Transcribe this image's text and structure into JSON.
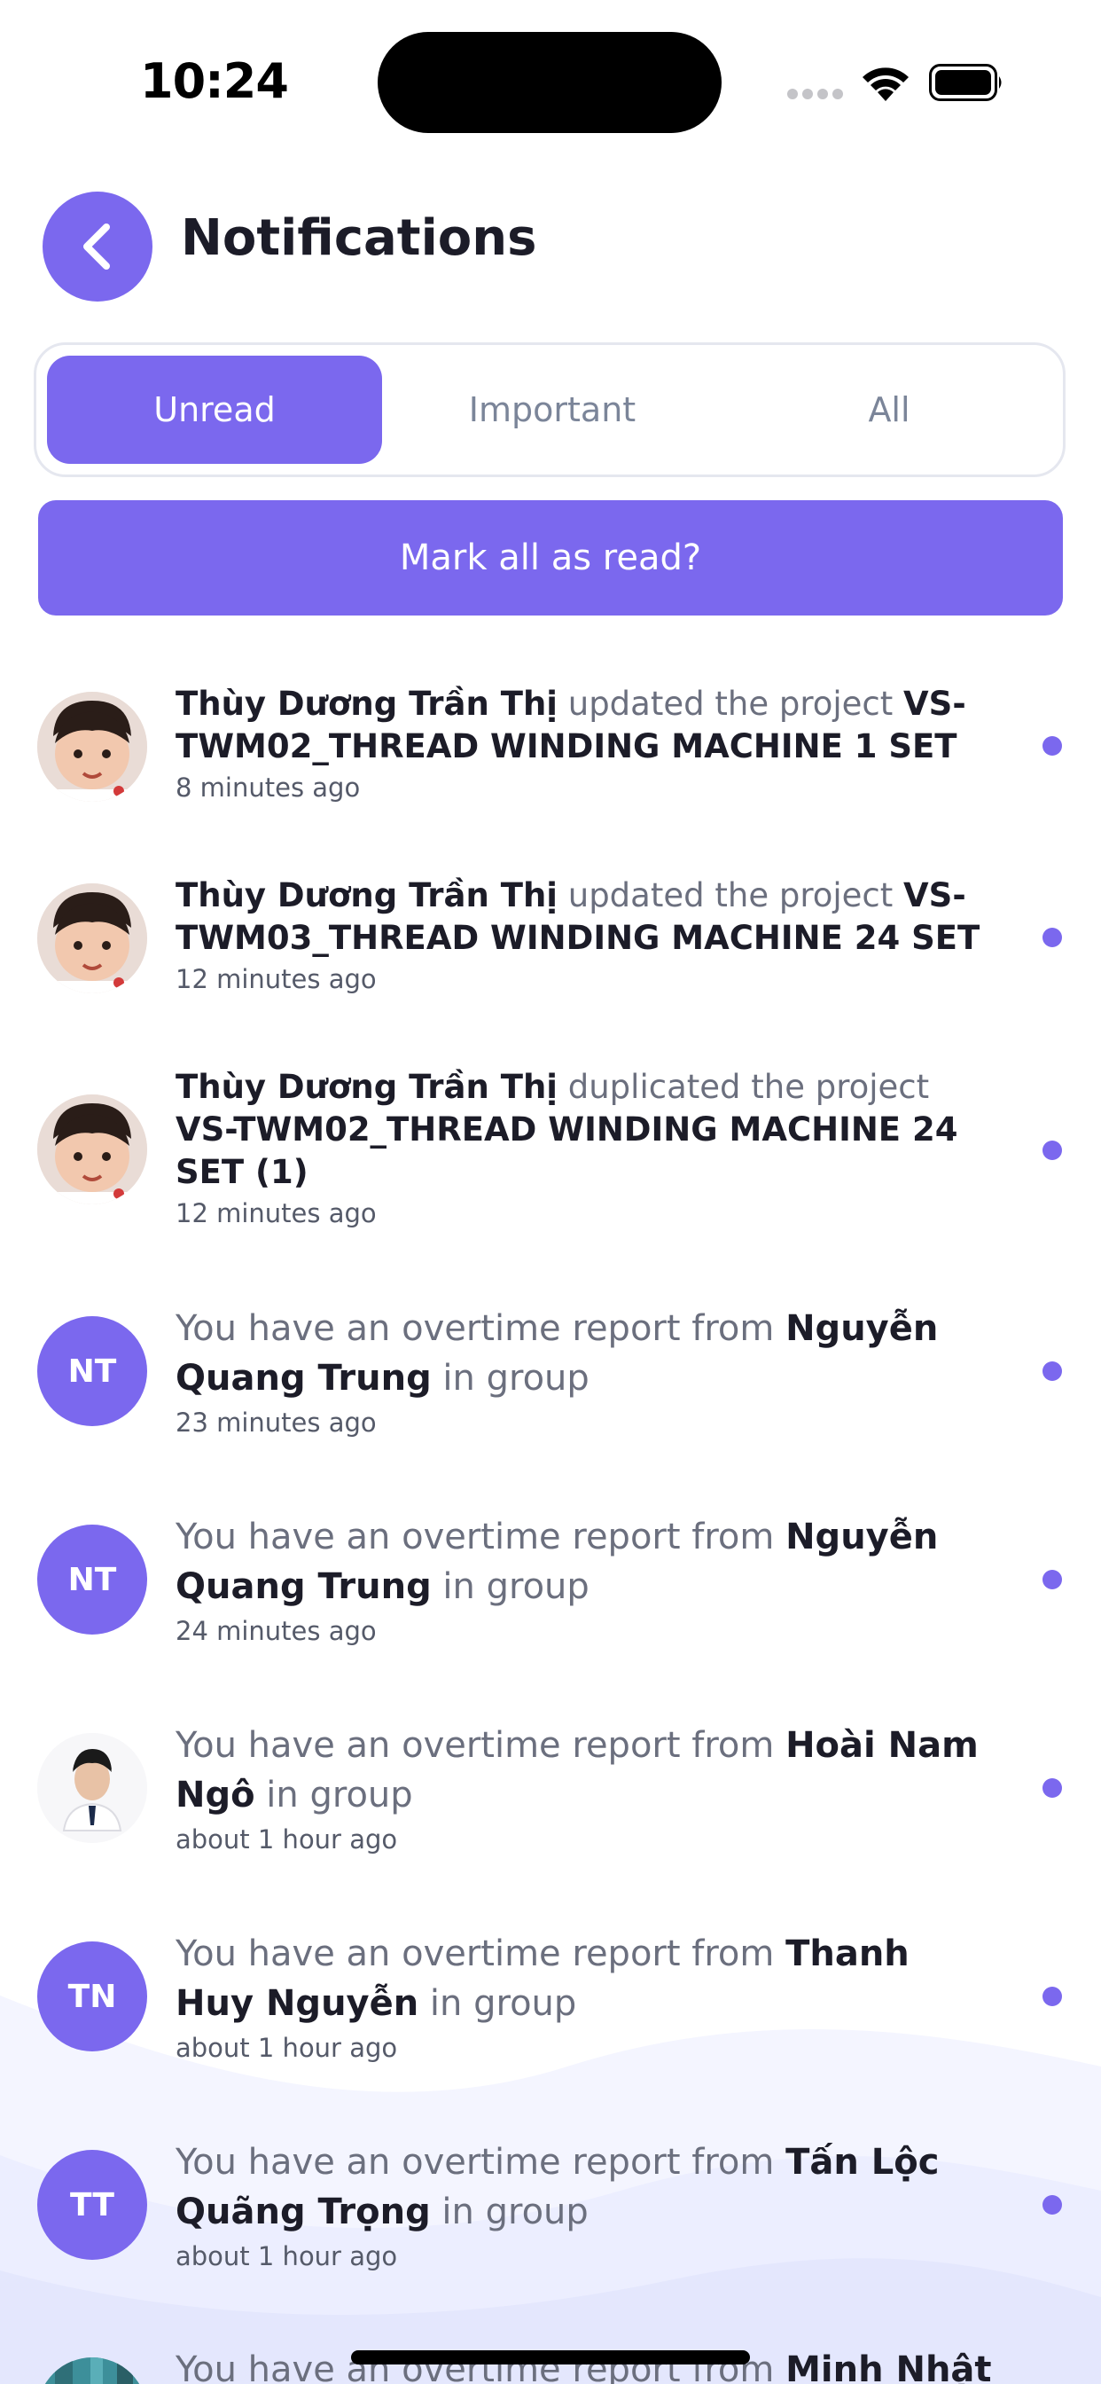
{
  "status_bar": {
    "time": "10:24"
  },
  "header": {
    "title": "Notifications",
    "back_icon": "chevron-left-icon"
  },
  "tabs": [
    {
      "label": "Unread",
      "active": true
    },
    {
      "label": "Important",
      "active": false
    },
    {
      "label": "All",
      "active": false
    }
  ],
  "mark_all_label": "Mark all as read?",
  "colors": {
    "accent": "#7b68ee",
    "title": "#1c1c28",
    "muted": "#6b6f7e",
    "tab_inactive": "#7b8599",
    "wave": "#eceeff"
  },
  "notifications": [
    {
      "actor": "Thùy Dương Trần Thị",
      "action": " updated the project ",
      "target": "VS-TWM02_THREAD WINDING MACHINE 1 SET",
      "time": "8 minutes ago",
      "avatar": "child-photo",
      "unread": true
    },
    {
      "actor": "Thùy Dương Trần Thị",
      "action": " updated the project ",
      "target": "VS-TWM03_THREAD WINDING MACHINE 24 SET",
      "time": "12 minutes ago",
      "avatar": "child-photo",
      "unread": true
    },
    {
      "actor": "Thùy Dương Trần Thị",
      "action": " duplicated the project ",
      "target": "VS-TWM02_THREAD WINDING MACHINE 24 SET (1)",
      "time": "12 minutes ago",
      "avatar": "child-photo",
      "unread": true
    },
    {
      "prefix": "You have an overtime report from ",
      "name": "Nguyễn Quang Trung",
      "suffix": " in group",
      "time": "23 minutes ago",
      "initials": "NT",
      "unread": true
    },
    {
      "prefix": "You have an overtime report from ",
      "name": "Nguyễn Quang Trung",
      "suffix": " in group",
      "time": "24 minutes ago",
      "initials": "NT",
      "unread": true
    },
    {
      "prefix": "You have an overtime report from ",
      "name": "Hoài Nam Ngô",
      "suffix": " in group",
      "time": "about 1 hour ago",
      "avatar": "man-photo",
      "unread": true
    },
    {
      "prefix": "You have an overtime report from ",
      "name": "Thanh Huy Nguyễn",
      "suffix": " in group",
      "time": "about 1 hour ago",
      "initials": "TN",
      "unread": true
    },
    {
      "prefix": "You have an overtime report from ",
      "name": "Tấn Lộc Quãng Trọng",
      "suffix": " in group",
      "time": "about 1 hour ago",
      "initials": "TT",
      "unread": true
    },
    {
      "prefix": "You have an overtime report from ",
      "name": "Minh Nhật",
      "avatar": "building-photo",
      "unread": true
    }
  ]
}
